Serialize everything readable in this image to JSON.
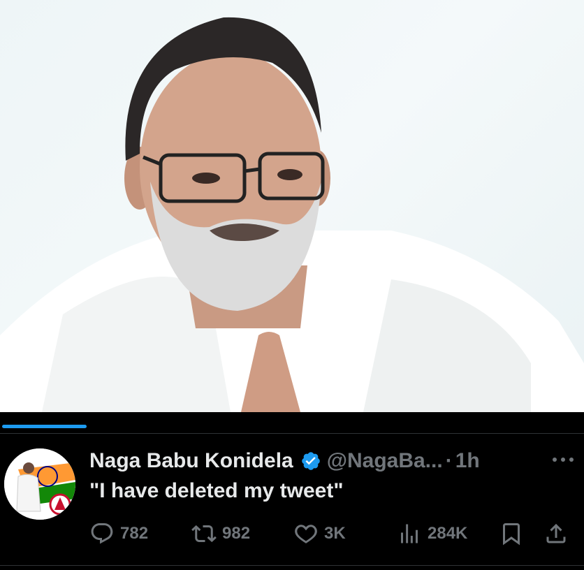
{
  "media": {
    "alt": "Photo"
  },
  "video": {
    "progress": 0.145
  },
  "tweet": {
    "author_name": "Naga Babu Konidela",
    "handle": "@NagaBa...",
    "separator": "·",
    "time": "1h",
    "text": "\"I have deleted my tweet\""
  },
  "actions": {
    "reply_count": "782",
    "repost_count": "982",
    "like_count": "3K",
    "views_count": "284K"
  },
  "colors": {
    "accent": "#1d9bf0",
    "text": "#e7e9ea",
    "muted": "#71767b",
    "background": "#000000"
  },
  "icons": [
    "verified-badge-icon",
    "more-icon",
    "reply-icon",
    "repost-icon",
    "like-icon",
    "views-icon",
    "bookmark-icon",
    "share-icon"
  ]
}
